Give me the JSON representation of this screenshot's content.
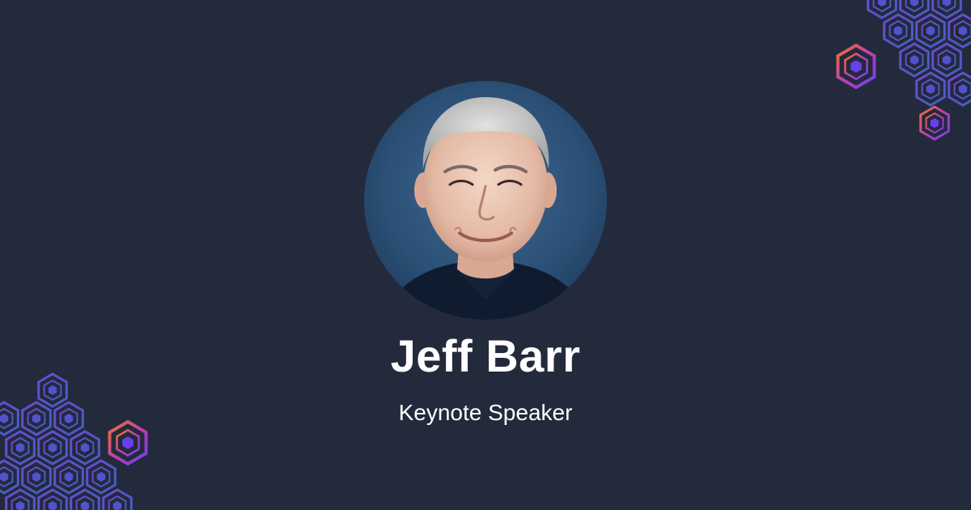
{
  "speaker": {
    "name": "Jeff Barr",
    "role": "Keynote Speaker"
  },
  "colors": {
    "background": "#232a3c",
    "text": "#ffffff",
    "hex_purple": "#6a3ff0",
    "hex_magenta": "#c03fb0",
    "hex_orange": "#f0702a",
    "hex_blue": "#4a6ad8"
  },
  "icons": {
    "decoration": "hexagon-cube-icon"
  }
}
